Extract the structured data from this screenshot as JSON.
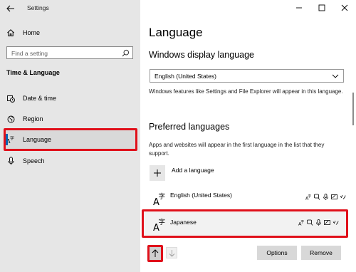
{
  "window": {
    "title": "Settings"
  },
  "sidebar": {
    "home_label": "Home",
    "search_placeholder": "Find a setting",
    "section_title": "Time & Language",
    "items": [
      {
        "label": "Date & time",
        "icon": "calendar-clock-icon"
      },
      {
        "label": "Region",
        "icon": "globe-region-icon"
      },
      {
        "label": "Language",
        "icon": "language-icon",
        "selected": true
      },
      {
        "label": "Speech",
        "icon": "microphone-icon"
      }
    ]
  },
  "main": {
    "page_title": "Language",
    "display_language": {
      "heading": "Windows display language",
      "selected_value": "English (United States)",
      "description": "Windows features like Settings and File Explorer will appear in this language."
    },
    "preferred": {
      "heading": "Preferred languages",
      "description": "Apps and websites will appear in the first language in the list that they support.",
      "add_label": "Add a language",
      "languages": [
        {
          "name": "English (United States)"
        },
        {
          "name": "Japanese",
          "selected": true
        }
      ],
      "options_label": "Options",
      "remove_label": "Remove"
    }
  },
  "colors": {
    "highlight": "#e0101a",
    "accent": "#0063b1"
  }
}
